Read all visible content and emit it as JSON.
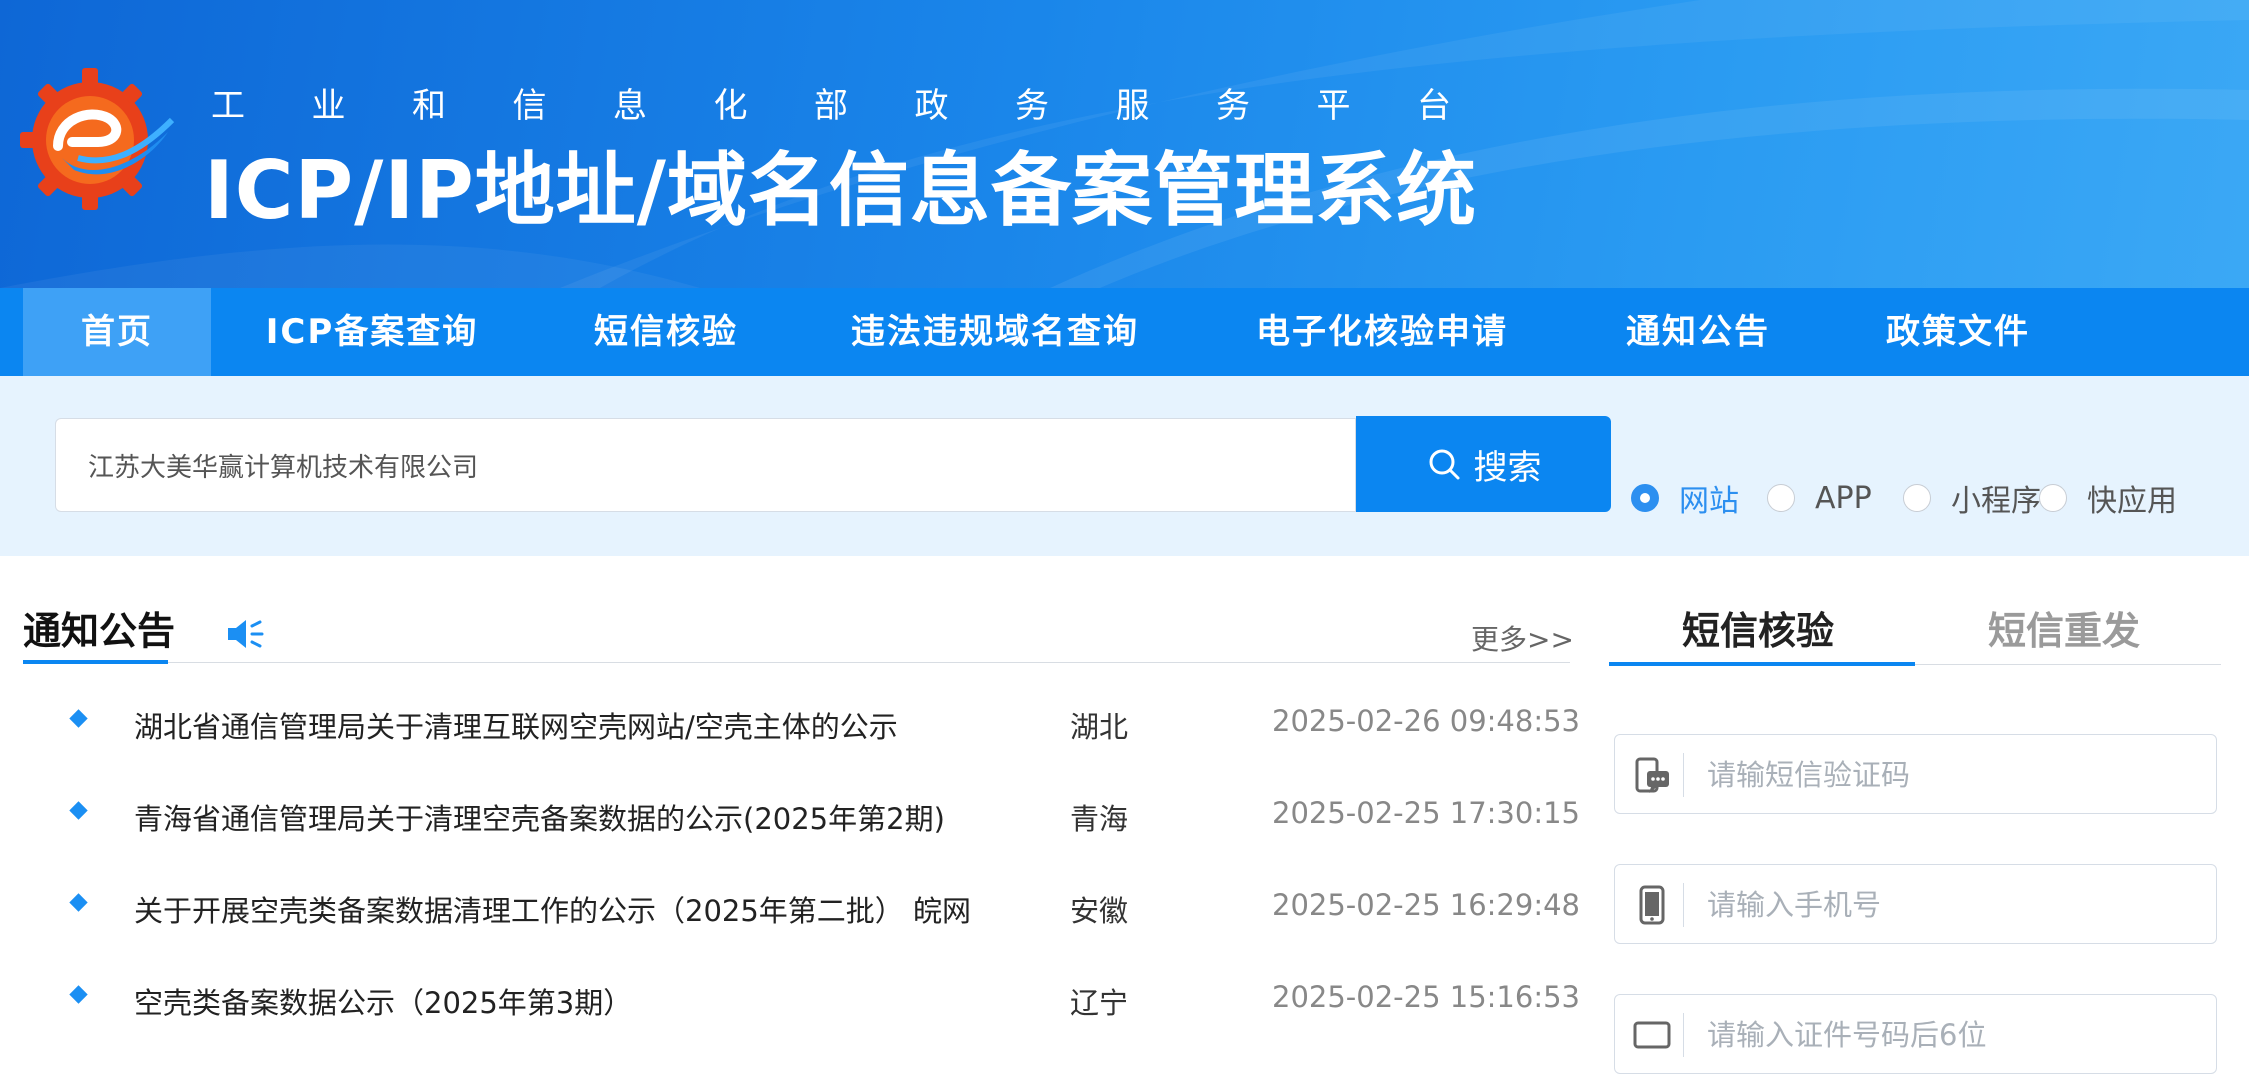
{
  "header": {
    "subtitle_chars": [
      "工",
      "业",
      "和",
      "信",
      "息",
      "化",
      "部",
      "政",
      "务",
      "服",
      "务",
      "平",
      "台"
    ],
    "title": "ICP/IP地址/域名信息备案管理系统",
    "logo_icon": "gear-e-logo-icon"
  },
  "nav": {
    "items": [
      {
        "label": "首页",
        "active": true
      },
      {
        "label": "ICP备案查询",
        "active": false
      },
      {
        "label": "短信核验",
        "active": false
      },
      {
        "label": "违法违规域名查询",
        "active": false
      },
      {
        "label": "电子化核验申请",
        "active": false
      },
      {
        "label": "通知公告",
        "active": false
      },
      {
        "label": "政策文件",
        "active": false
      }
    ]
  },
  "search": {
    "value": "江苏大美华赢计算机技术有限公司",
    "button_label": "搜索",
    "types": [
      {
        "label": "网站",
        "checked": true
      },
      {
        "label": "APP",
        "checked": false
      },
      {
        "label": "小程序",
        "checked": false
      },
      {
        "label": "快应用",
        "checked": false
      }
    ]
  },
  "notices": {
    "title": "通知公告",
    "more": "更多>>",
    "items": [
      {
        "text": "湖北省通信管理局关于清理互联网空壳网站/空壳主体的公示",
        "region": "湖北",
        "date": "2025-02-26 09:48:53"
      },
      {
        "text": "青海省通信管理局关于清理空壳备案数据的公示(2025年第2期)",
        "region": "青海",
        "date": "2025-02-25 17:30:15"
      },
      {
        "text": "关于开展空壳类备案数据清理工作的公示（2025年第二批） 皖网",
        "region": "安徽",
        "date": "2025-02-25 16:29:48"
      },
      {
        "text": "空壳类备案数据公示（2025年第3期）",
        "region": "辽宁",
        "date": "2025-02-25 15:16:53"
      }
    ]
  },
  "sms": {
    "tabs": [
      {
        "label": "短信核验",
        "active": true
      },
      {
        "label": "短信重发",
        "active": false
      }
    ],
    "code_placeholder": "请输短信验证码",
    "phone_placeholder": "请输入手机号",
    "third_placeholder": "请输入证件号码后6位"
  },
  "colors": {
    "brand_blue": "#0b86f1",
    "nav_active": "#3ea1f6",
    "search_band": "#e6f3fe"
  }
}
